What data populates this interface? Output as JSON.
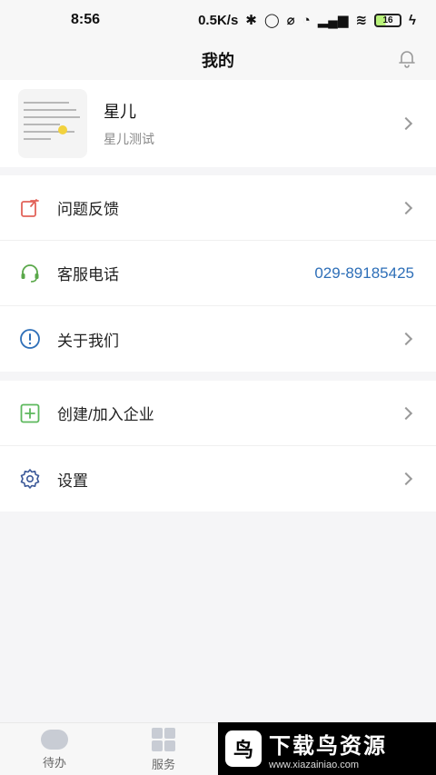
{
  "status_bar": {
    "time": "8:56",
    "net_speed": "0.5K/s",
    "battery": "16"
  },
  "header": {
    "title": "我的",
    "bell_icon": "bell-icon"
  },
  "profile": {
    "name": "星儿",
    "subtitle": "星儿测试"
  },
  "menu_group_1": [
    {
      "label": "问题反馈",
      "icon": "feedback-icon",
      "color": "#e2635a"
    },
    {
      "label": "客服电话",
      "icon": "headset-icon",
      "color": "#5aa84a",
      "value": "029-89185425"
    },
    {
      "label": "关于我们",
      "icon": "info-icon",
      "color": "#2e6fb8"
    }
  ],
  "menu_group_2": [
    {
      "label": "创建/加入企业",
      "icon": "add-square-icon",
      "color": "#5cb85c"
    },
    {
      "label": "设置",
      "icon": "gear-icon",
      "color": "#3d5a99"
    }
  ],
  "tabbar": {
    "tabs": [
      {
        "label": "待办",
        "icon": "chat-bubble-icon"
      },
      {
        "label": "服务",
        "icon": "grid-icon"
      }
    ]
  },
  "watermark": {
    "logo_glyph": "鸟",
    "title": "下载鸟资源",
    "url": "www.xiazainiao.com"
  },
  "colors": {
    "accent_blue": "#2e6fb8",
    "background": "#f5f5f7"
  }
}
